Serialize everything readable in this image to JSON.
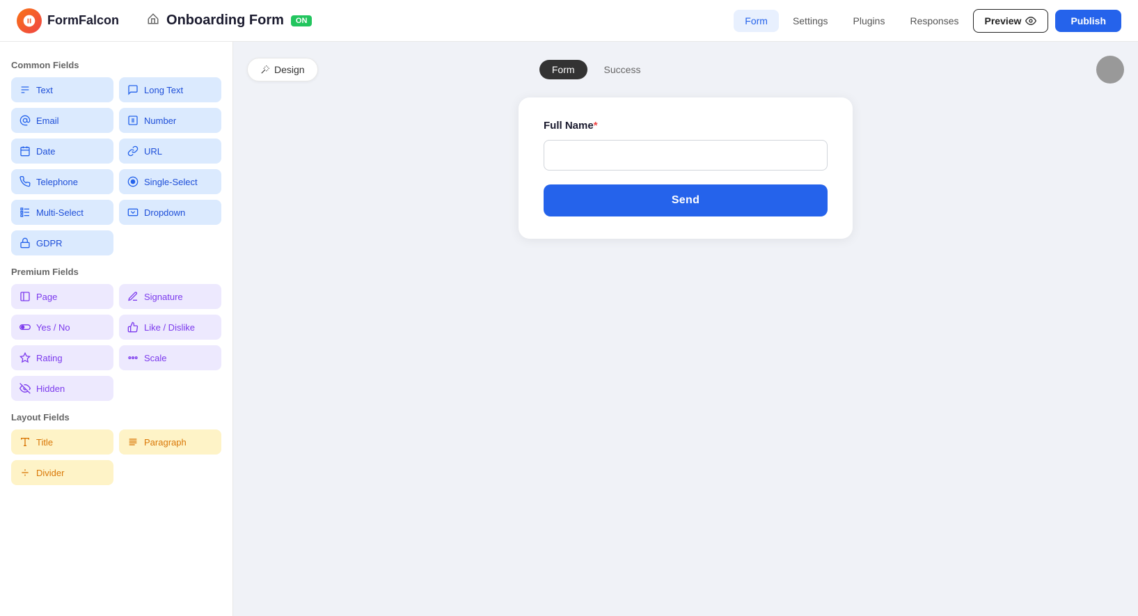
{
  "app": {
    "name": "FormFalcon"
  },
  "navbar": {
    "form_name": "Onboarding Form",
    "on_badge": "ON",
    "nav_items": [
      "Form",
      "Settings",
      "Plugins",
      "Responses"
    ],
    "active_nav": "Form",
    "preview_label": "Preview",
    "publish_label": "Publish"
  },
  "sidebar": {
    "common_label": "Common Fields",
    "common_fields": [
      {
        "id": "text",
        "label": "Text",
        "icon": "text-icon"
      },
      {
        "id": "long-text",
        "label": "Long Text",
        "icon": "longtext-icon"
      },
      {
        "id": "email",
        "label": "Email",
        "icon": "email-icon"
      },
      {
        "id": "number",
        "label": "Number",
        "icon": "number-icon"
      },
      {
        "id": "date",
        "label": "Date",
        "icon": "date-icon"
      },
      {
        "id": "url",
        "label": "URL",
        "icon": "url-icon"
      },
      {
        "id": "telephone",
        "label": "Telephone",
        "icon": "phone-icon"
      },
      {
        "id": "single-select",
        "label": "Single-Select",
        "icon": "single-select-icon"
      },
      {
        "id": "multi-select",
        "label": "Multi-Select",
        "icon": "multiselect-icon"
      },
      {
        "id": "dropdown",
        "label": "Dropdown",
        "icon": "dropdown-icon"
      },
      {
        "id": "gdpr",
        "label": "GDPR",
        "icon": "gdpr-icon"
      }
    ],
    "premium_label": "Premium Fields",
    "premium_fields": [
      {
        "id": "page",
        "label": "Page",
        "icon": "page-icon"
      },
      {
        "id": "signature",
        "label": "Signature",
        "icon": "signature-icon"
      },
      {
        "id": "yes-no",
        "label": "Yes / No",
        "icon": "yesno-icon"
      },
      {
        "id": "like-dislike",
        "label": "Like / Dislike",
        "icon": "like-icon"
      },
      {
        "id": "rating",
        "label": "Rating",
        "icon": "rating-icon"
      },
      {
        "id": "scale",
        "label": "Scale",
        "icon": "scale-icon"
      },
      {
        "id": "hidden",
        "label": "Hidden",
        "icon": "hidden-icon"
      }
    ],
    "layout_label": "Layout Fields",
    "layout_fields": [
      {
        "id": "title",
        "label": "Title",
        "icon": "title-icon"
      },
      {
        "id": "paragraph",
        "label": "Paragraph",
        "icon": "paragraph-icon"
      },
      {
        "id": "divider",
        "label": "Divider",
        "icon": "divider-icon"
      }
    ]
  },
  "canvas": {
    "design_btn": "Design",
    "tab_form": "Form",
    "tab_success": "Success",
    "form": {
      "field_label": "Full Name",
      "required": true,
      "send_btn": "Send"
    }
  }
}
